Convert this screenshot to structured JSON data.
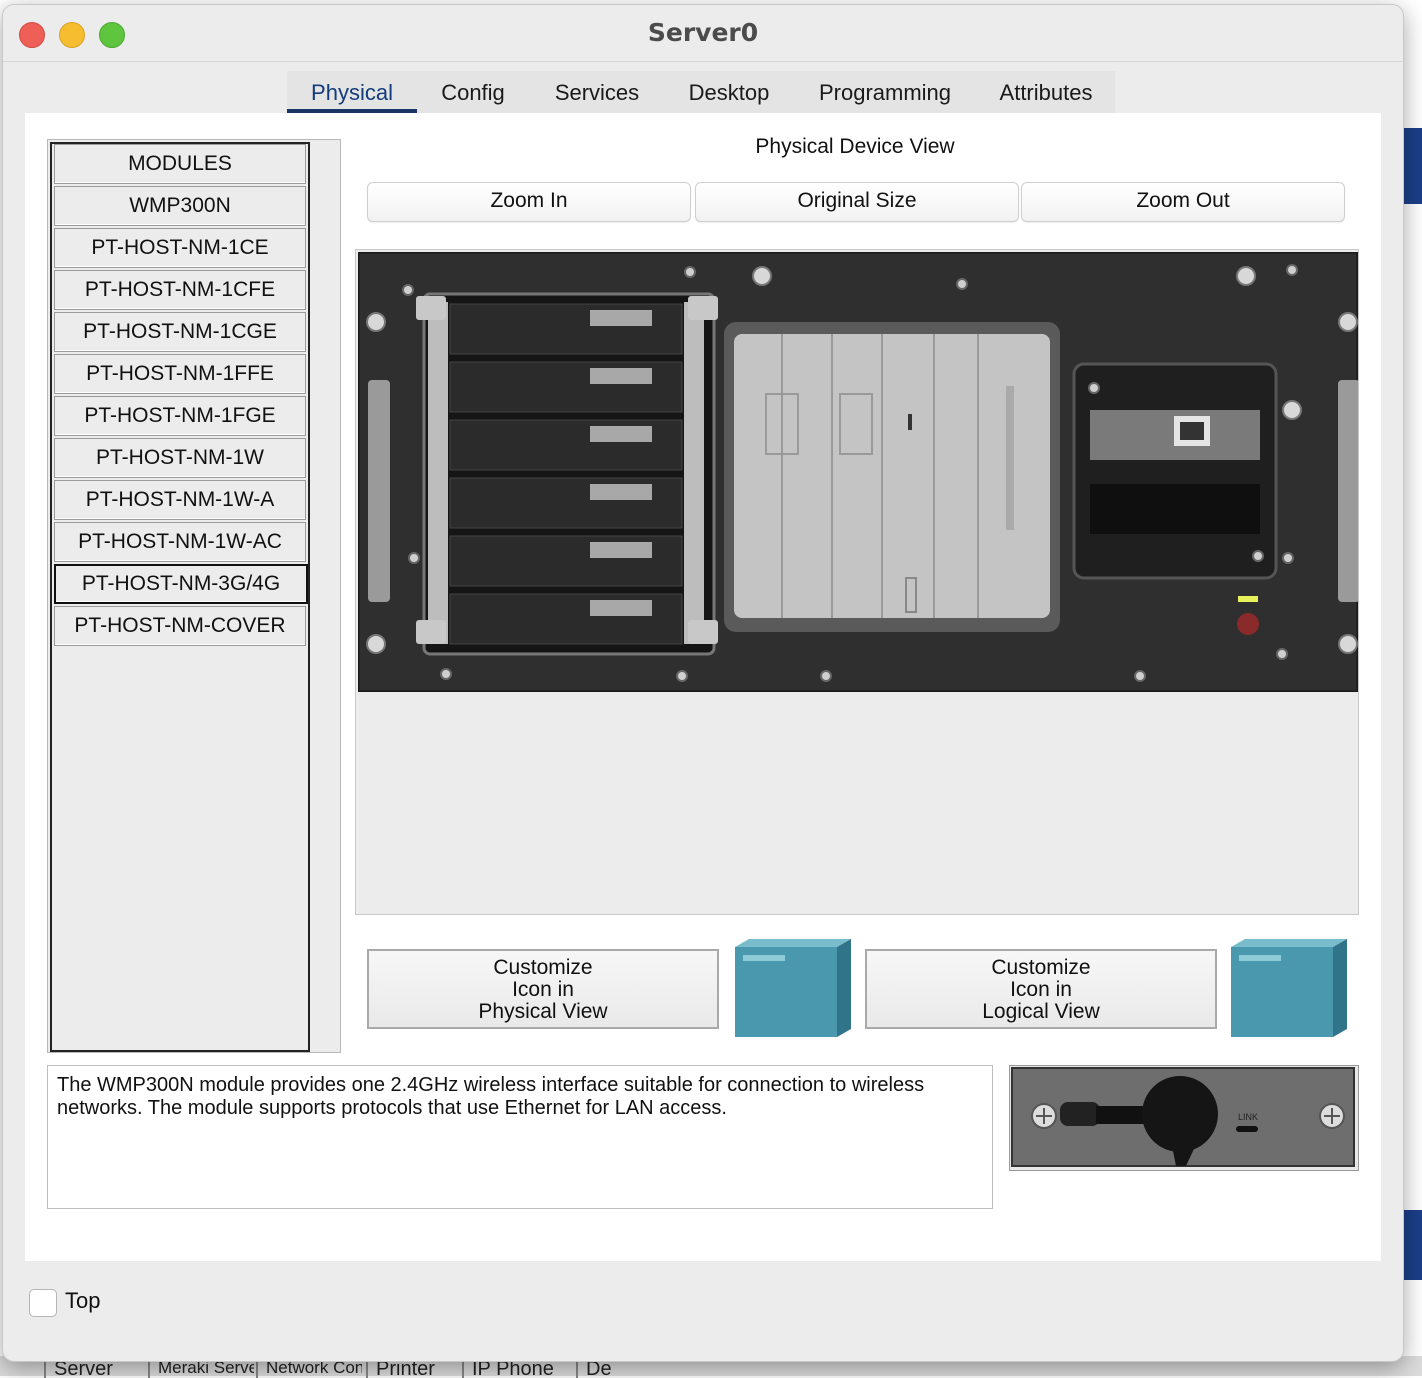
{
  "window": {
    "title": "Server0"
  },
  "tabs": [
    "Physical",
    "Config",
    "Services",
    "Desktop",
    "Programming",
    "Attributes"
  ],
  "active_tab": "Physical",
  "modules": {
    "items": [
      "MODULES",
      "WMP300N",
      "PT-HOST-NM-1CE",
      "PT-HOST-NM-1CFE",
      "PT-HOST-NM-1CGE",
      "PT-HOST-NM-1FFE",
      "PT-HOST-NM-1FGE",
      "PT-HOST-NM-1W",
      "PT-HOST-NM-1W-A",
      "PT-HOST-NM-1W-AC",
      "PT-HOST-NM-3G/4G",
      "PT-HOST-NM-COVER"
    ],
    "selected": "PT-HOST-NM-3G/4G"
  },
  "physical_view": {
    "title": "Physical Device View",
    "zoom_in": "Zoom In",
    "original_size": "Original Size",
    "zoom_out": "Zoom Out"
  },
  "customize": {
    "physical": [
      "Customize",
      "Icon in",
      "Physical View"
    ],
    "logical": [
      "Customize",
      "Icon in",
      "Logical View"
    ]
  },
  "description": "The WMP300N module provides one 2.4GHz wireless interface suitable for connection to wireless networks. The module supports protocols that use Ethernet for LAN access.",
  "module_image": {
    "label": "LINK"
  },
  "top_checkbox": {
    "label": "Top",
    "checked": false
  },
  "background_tabs": [
    "Server",
    "Meraki Server",
    "Network Controller",
    "Printer",
    "IP Phone",
    "De"
  ],
  "colors": {
    "accent": "#1a3464",
    "cube": "#4a98ad",
    "device_panel": "#2e2e2e"
  }
}
